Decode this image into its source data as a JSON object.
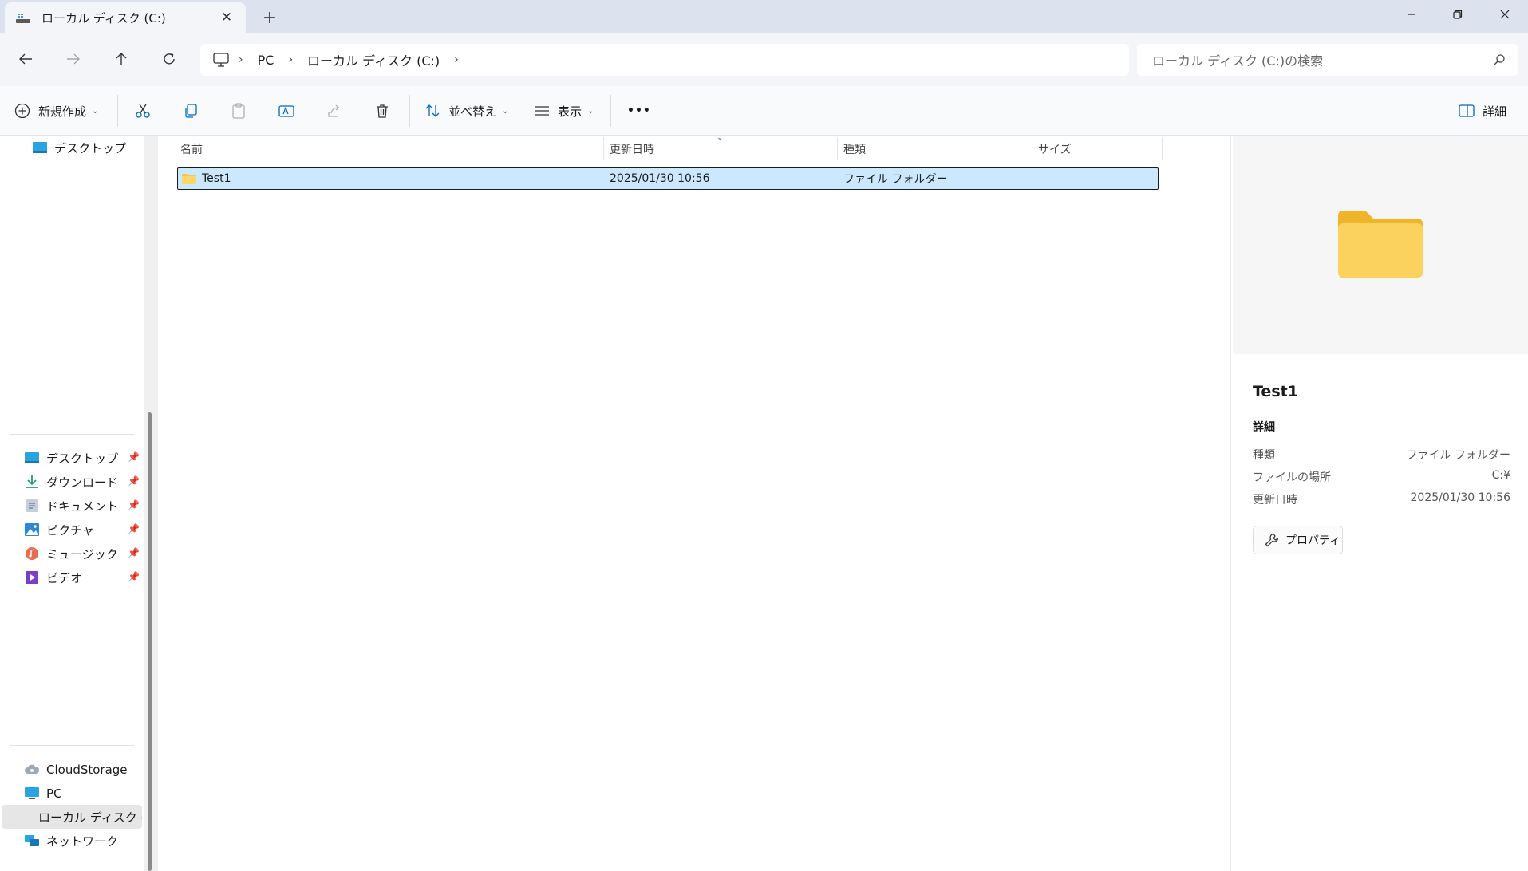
{
  "window": {
    "tab_title": "ローカル ディスク (C:)",
    "tab_close": "✕",
    "new_tab": "+"
  },
  "address": {
    "crumbs": [
      "PC",
      "ローカル ディスク (C:)"
    ],
    "search_placeholder": "ローカル ディスク (C:)の検索"
  },
  "toolbar": {
    "new_label": "新規作成",
    "sort_label": "並べ替え",
    "view_label": "表示",
    "more_label": "•••",
    "details_label": "詳細"
  },
  "nav": {
    "top_item": "デスクトップ",
    "quick_access": [
      {
        "label": "デスクトップ",
        "icon": "desktop-icon"
      },
      {
        "label": "ダウンロード",
        "icon": "download-icon"
      },
      {
        "label": "ドキュメント",
        "icon": "document-icon"
      },
      {
        "label": "ピクチャ",
        "icon": "pictures-icon"
      },
      {
        "label": "ミュージック",
        "icon": "music-icon"
      },
      {
        "label": "ビデオ",
        "icon": "video-icon"
      }
    ],
    "bottom_items": [
      {
        "label": "CloudStorage",
        "icon": "cloud-storage-icon"
      },
      {
        "label": "PC",
        "icon": "pc-icon"
      },
      {
        "label": "ローカル ディスク (C:",
        "icon": "drive-icon"
      },
      {
        "label": "ネットワーク",
        "icon": "network-icon"
      }
    ]
  },
  "filelist": {
    "columns": [
      "名前",
      "更新日時",
      "種類",
      "サイズ"
    ],
    "rows": [
      {
        "name": "Test1",
        "modified": "2025/01/30 10:56",
        "type": "ファイル フォルダー",
        "size": ""
      }
    ]
  },
  "details": {
    "title": "Test1",
    "section": "詳細",
    "fields": [
      {
        "label": "種類",
        "value": "ファイル フォルダー"
      },
      {
        "label": "ファイルの場所",
        "value": "C:¥"
      },
      {
        "label": "更新日時",
        "value": "2025/01/30 10:56"
      }
    ],
    "properties_label": "プロパティ"
  },
  "colors": {
    "accent": "#0067c0",
    "selection": "#cce8ff",
    "folder": "#f8c74a"
  }
}
